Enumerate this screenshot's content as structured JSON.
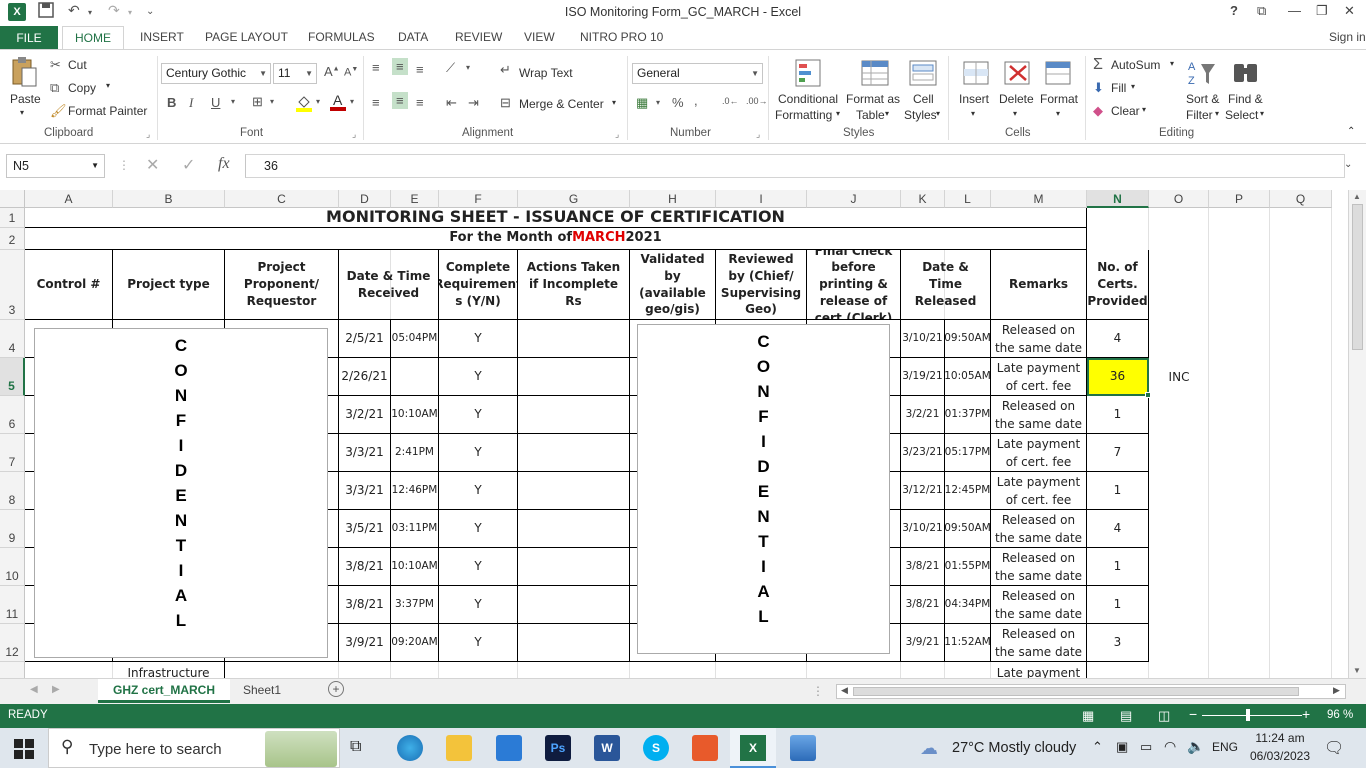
{
  "window": {
    "title": "ISO Monitoring Form_GC_MARCH - Excel",
    "signin": "Sign in",
    "help": "?"
  },
  "tabs": [
    "FILE",
    "HOME",
    "INSERT",
    "PAGE LAYOUT",
    "FORMULAS",
    "DATA",
    "REVIEW",
    "VIEW",
    "NITRO PRO 10"
  ],
  "ribbon": {
    "clipboard": {
      "paste": "Paste",
      "cut": "Cut",
      "copy": "Copy",
      "format_painter": "Format Painter",
      "label": "Clipboard"
    },
    "font": {
      "family": "Century Gothic",
      "size": "11",
      "label": "Font",
      "bold": "B",
      "italic": "I",
      "underline": "U"
    },
    "alignment": {
      "wrap": "Wrap Text",
      "merge": "Merge & Center",
      "label": "Alignment"
    },
    "number": {
      "format": "General",
      "label": "Number",
      "percent": "%"
    },
    "styles": {
      "cond": "Conditional",
      "cond2": "Formatting",
      "fmt_table": "Format as",
      "fmt_table2": "Table",
      "cell_styles": "Cell",
      "cell_styles2": "Styles",
      "label": "Styles"
    },
    "cells": {
      "insert": "Insert",
      "delete": "Delete",
      "format": "Format",
      "label": "Cells"
    },
    "editing": {
      "autosum": "AutoSum",
      "fill": "Fill",
      "clear": "Clear",
      "sort": "Sort &",
      "sort2": "Filter",
      "find": "Find &",
      "find2": "Select",
      "label": "Editing"
    }
  },
  "formula_bar": {
    "name_box": "N5",
    "fx": "fx",
    "value": "36"
  },
  "columns": [
    "A",
    "B",
    "C",
    "D",
    "E",
    "F",
    "G",
    "H",
    "I",
    "J",
    "K",
    "L",
    "M",
    "N",
    "O",
    "P",
    "Q"
  ],
  "rows": [
    "1",
    "2",
    "3",
    "4",
    "5",
    "6",
    "7",
    "8",
    "9",
    "10",
    "11",
    "12"
  ],
  "sheet": {
    "title": "MONITORING SHEET - ISSUANCE OF CERTIFICATION",
    "subtitle_pre": "For the Month of ",
    "subtitle_month": "MARCH",
    "subtitle_year": " 2021",
    "headers": {
      "control": "Control #",
      "project_type": "Project type",
      "proponent": "Project Proponent/ Requestor",
      "received": "Date & Time Received",
      "complete": "Complete Requirement s (Y/N)",
      "actions": "Actions Taken if Incomplete Rs",
      "validated": "Validated by (available geo/gis)",
      "reviewed": "Reviewed by (Chief/ Supervising Geo)",
      "final": "Final Check before printing & release of cert.(Clerk)",
      "released": "Date & Time Released",
      "remarks": "Remarks",
      "certs": "No. of Certs. Provided"
    },
    "data_rows": [
      {
        "recv_date": "2/5/21",
        "recv_time": "05:04PM",
        "complete": "Y",
        "rel_date": "3/10/21",
        "rel_time": "09:50AM",
        "remarks": "Released on the same date",
        "certs": "4",
        "extra": ""
      },
      {
        "recv_date": "2/26/21",
        "recv_time": "",
        "complete": "Y",
        "rel_date": "3/19/21",
        "rel_time": "10:05AM",
        "remarks": "Late payment of cert. fee",
        "certs": "36",
        "extra": "INC"
      },
      {
        "recv_date": "3/2/21",
        "recv_time": "10:10AM",
        "complete": "Y",
        "rel_date": "3/2/21",
        "rel_time": "01:37PM",
        "remarks": "Released on the same date",
        "certs": "1",
        "extra": ""
      },
      {
        "recv_date": "3/3/21",
        "recv_time": "2:41PM",
        "complete": "Y",
        "rel_date": "3/23/21",
        "rel_time": "05:17PM",
        "remarks": "Late payment of cert. fee",
        "certs": "7",
        "extra": ""
      },
      {
        "recv_date": "3/3/21",
        "recv_time": "12:46PM",
        "complete": "Y",
        "rel_date": "3/12/21",
        "rel_time": "12:45PM",
        "remarks": "Late payment of cert. fee",
        "certs": "1",
        "extra": ""
      },
      {
        "recv_date": "3/5/21",
        "recv_time": "03:11PM",
        "complete": "Y",
        "rel_date": "3/10/21",
        "rel_time": "09:50AM",
        "remarks": "Released on the same date",
        "certs": "4",
        "extra": ""
      },
      {
        "recv_date": "3/8/21",
        "recv_time": "10:10AM",
        "complete": "Y",
        "rel_date": "3/8/21",
        "rel_time": "01:55PM",
        "remarks": "Released on the same date",
        "certs": "1",
        "extra": ""
      },
      {
        "recv_date": "3/8/21",
        "recv_time": "3:37PM",
        "complete": "Y",
        "rel_date": "3/8/21",
        "rel_time": "04:34PM",
        "remarks": "Released on the same date",
        "certs": "1",
        "extra": ""
      },
      {
        "recv_date": "3/9/21",
        "recv_time": "09:20AM",
        "complete": "Y",
        "rel_date": "3/9/21",
        "rel_time": "11:52AM",
        "remarks": "Released on the same date",
        "certs": "3",
        "extra": ""
      }
    ],
    "partial_row": {
      "project_type": "Infrastructure",
      "remarks": "Late payment"
    },
    "confidential": [
      "C",
      "O",
      "N",
      "F",
      "I",
      "D",
      "E",
      "N",
      "T",
      "I",
      "A",
      "L"
    ]
  },
  "sheet_tabs": [
    "GHZ cert_MARCH",
    "Sheet1"
  ],
  "status": {
    "ready": "READY",
    "zoom": "96 %"
  },
  "taskbar": {
    "search": "Type here to search",
    "weather": "27°C  Mostly cloudy",
    "lang": "ENG",
    "time": "11:24 am",
    "date": "06/03/2023"
  },
  "colors": {
    "excel_green": "#217346",
    "selected_cell": "#ffff00",
    "month_red": "#e00000"
  }
}
